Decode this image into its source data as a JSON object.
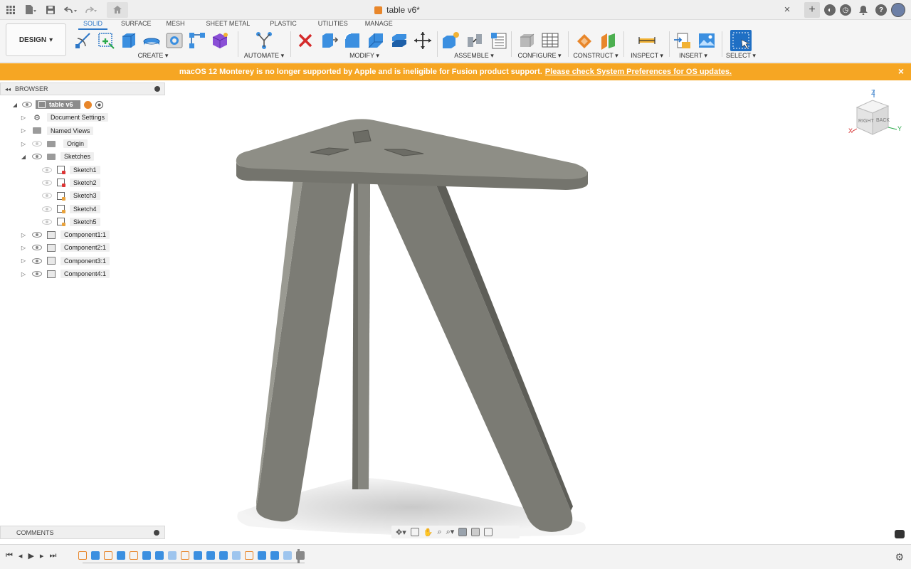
{
  "window": {
    "doc_title": "table v6*",
    "tab_close": "×",
    "new_tab": "+"
  },
  "toolbar": {
    "workspace": "DESIGN",
    "workspace_tabs": [
      "SOLID",
      "SURFACE",
      "MESH",
      "SHEET METAL",
      "PLASTIC",
      "UTILITIES",
      "MANAGE"
    ],
    "active_tab": "SOLID",
    "groups": {
      "create": "CREATE",
      "automate": "AUTOMATE",
      "modify": "MODIFY",
      "assemble": "ASSEMBLE",
      "configure": "CONFIGURE",
      "construct": "CONSTRUCT",
      "inspect": "INSPECT",
      "insert": "INSERT",
      "select": "SELECT"
    }
  },
  "banner": {
    "message": "macOS 12 Monterey is no longer supported by Apple and is ineligible for Fusion product support.",
    "link": "Please check System Preferences for OS updates.",
    "close": "×"
  },
  "browser": {
    "title": "BROWSER",
    "root": "table v6",
    "items": [
      {
        "label": "Document Settings"
      },
      {
        "label": "Named Views"
      },
      {
        "label": "Origin"
      },
      {
        "label": "Sketches"
      },
      {
        "label": "Sketch1"
      },
      {
        "label": "Sketch2"
      },
      {
        "label": "Sketch3"
      },
      {
        "label": "Sketch4"
      },
      {
        "label": "Sketch5"
      },
      {
        "label": "Component1:1"
      },
      {
        "label": "Component2:1"
      },
      {
        "label": "Component3:1"
      },
      {
        "label": "Component4:1"
      }
    ]
  },
  "comments": {
    "title": "COMMENTS"
  },
  "viewcube": {
    "z": "Z",
    "x": "X",
    "y": "Y",
    "right": "RIGHT",
    "back": "BACK"
  },
  "colors": {
    "accent": "#2d77c7",
    "banner": "#f6a623",
    "model": "#7a7a72"
  }
}
